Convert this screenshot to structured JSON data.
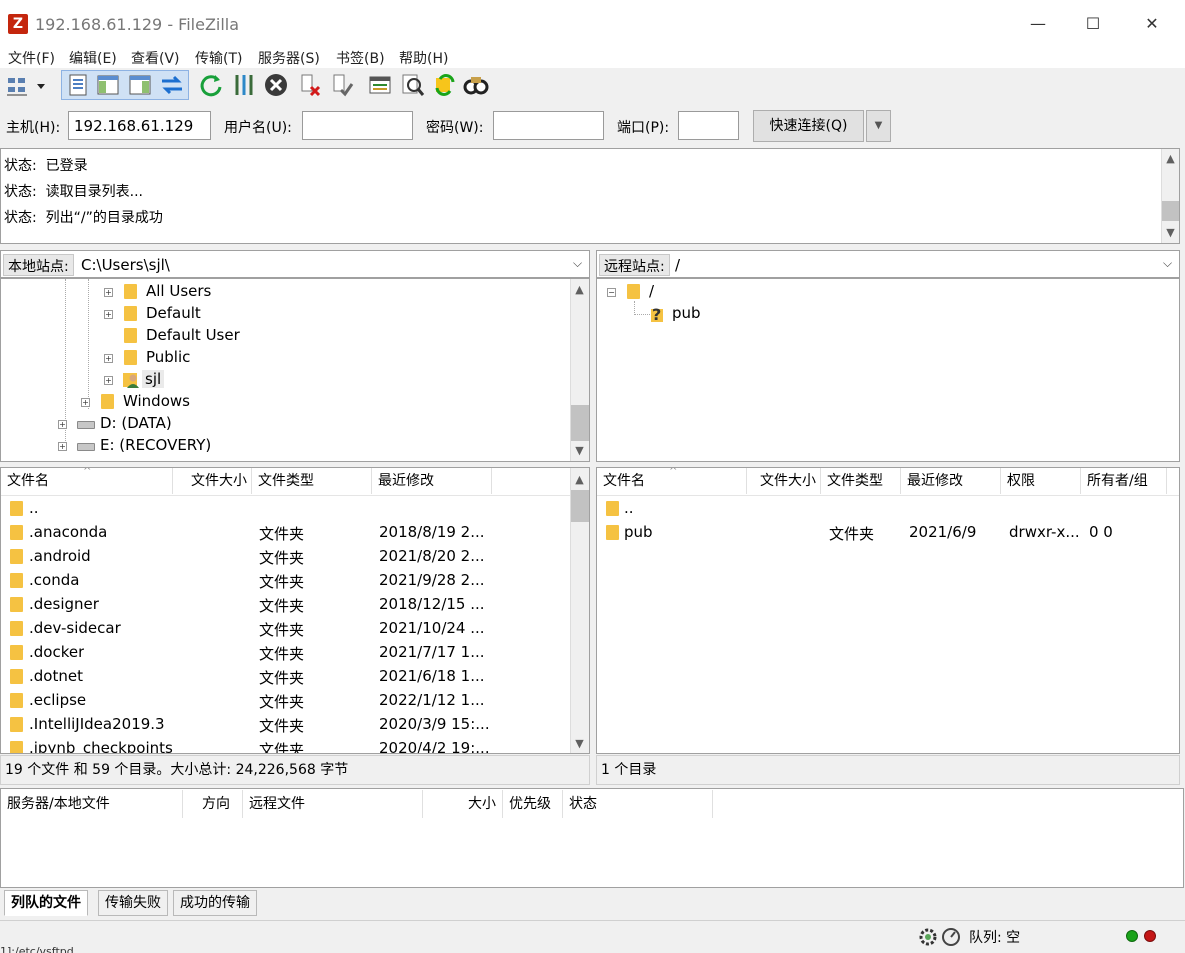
{
  "window": {
    "title": "192.168.61.129 - FileZilla",
    "app_icon_glyph": "Z",
    "minimize_glyph": "—",
    "maximize_glyph": "☐",
    "close_glyph": "✕"
  },
  "menu": [
    "文件(F)",
    "编辑(E)",
    "查看(V)",
    "传输(T)",
    "服务器(S)",
    "书签(B)",
    "帮助(H)"
  ],
  "toolbar": {
    "icons": [
      "site-manager-icon",
      "dropdown-icon",
      "toggle-log-icon",
      "toggle-local-tree-icon",
      "toggle-remote-tree-icon",
      "toggle-queue-icon",
      "refresh-icon",
      "process-queue-icon",
      "cancel-icon",
      "disconnect-icon",
      "reconnect-icon",
      "filter-icon",
      "compare-icon",
      "sync-browse-icon",
      "search-icon"
    ]
  },
  "quickconnect": {
    "host_label": "主机(H):",
    "host_value": "192.168.61.129",
    "user_label": "用户名(U):",
    "user_value": "",
    "pass_label": "密码(W):",
    "pass_value": "",
    "port_label": "端口(P):",
    "port_value": "",
    "button_label": "快速连接(Q)",
    "dropdown_glyph": "▼"
  },
  "log": [
    {
      "label": "状态:",
      "text": "已登录"
    },
    {
      "label": "状态:",
      "text": "读取目录列表..."
    },
    {
      "label": "状态:",
      "text": "列出“/”的目录成功"
    }
  ],
  "local": {
    "site_label": "本地站点:",
    "path": "C:\\Users\\sjl\\",
    "tree": [
      {
        "name": "All Users",
        "kind": "folder",
        "expander": "+"
      },
      {
        "name": "Default",
        "kind": "folder",
        "expander": "+"
      },
      {
        "name": "Default User",
        "kind": "folder",
        "expander": ""
      },
      {
        "name": "Public",
        "kind": "folder",
        "expander": "+"
      },
      {
        "name": "sjl",
        "kind": "user",
        "expander": "+"
      },
      {
        "name": "Windows",
        "kind": "folder",
        "expander": "+"
      },
      {
        "name": "D: (DATA)",
        "kind": "drive",
        "expander": "+"
      },
      {
        "name": "E: (RECOVERY)",
        "kind": "drive",
        "expander": "+"
      }
    ],
    "columns": [
      "文件名",
      "文件大小",
      "文件类型",
      "最近修改"
    ],
    "files": [
      {
        "name": "..",
        "size": "",
        "type": "",
        "modified": ""
      },
      {
        "name": ".anaconda",
        "size": "",
        "type": "文件夹",
        "modified": "2018/8/19 2..."
      },
      {
        "name": ".android",
        "size": "",
        "type": "文件夹",
        "modified": "2021/8/20 2..."
      },
      {
        "name": ".conda",
        "size": "",
        "type": "文件夹",
        "modified": "2021/9/28 2..."
      },
      {
        "name": ".designer",
        "size": "",
        "type": "文件夹",
        "modified": "2018/12/15 ..."
      },
      {
        "name": ".dev-sidecar",
        "size": "",
        "type": "文件夹",
        "modified": "2021/10/24 ..."
      },
      {
        "name": ".docker",
        "size": "",
        "type": "文件夹",
        "modified": "2021/7/17 1..."
      },
      {
        "name": ".dotnet",
        "size": "",
        "type": "文件夹",
        "modified": "2021/6/18 1..."
      },
      {
        "name": ".eclipse",
        "size": "",
        "type": "文件夹",
        "modified": "2022/1/12 1..."
      },
      {
        "name": ".IntelliJIdea2019.3",
        "size": "",
        "type": "文件夹",
        "modified": "2020/3/9 15:..."
      },
      {
        "name": ".ipynb_checkpoints",
        "size": "",
        "type": "文件夹",
        "modified": "2020/4/2 19:..."
      }
    ],
    "status": "19 个文件 和 59 个目录。大小总计: 24,226,568 字节"
  },
  "remote": {
    "site_label": "远程站点:",
    "path": "/",
    "tree": [
      {
        "name": "/",
        "kind": "folder",
        "expander": "−"
      },
      {
        "name": "pub",
        "kind": "unknown",
        "expander": ""
      }
    ],
    "columns": [
      "文件名",
      "文件大小",
      "文件类型",
      "最近修改",
      "权限",
      "所有者/组"
    ],
    "files": [
      {
        "name": "..",
        "size": "",
        "type": "",
        "modified": "",
        "perms": "",
        "owner": ""
      },
      {
        "name": "pub",
        "size": "",
        "type": "文件夹",
        "modified": "2021/6/9",
        "perms": "drwxr-x...",
        "owner": "0 0"
      }
    ],
    "status": "1 个目录"
  },
  "queue": {
    "columns": [
      "服务器/本地文件",
      "方向",
      "远程文件",
      "大小",
      "优先级",
      "状态"
    ],
    "tabs": [
      "列队的文件",
      "传输失败",
      "成功的传输"
    ],
    "active_tab": 0
  },
  "bottom": {
    "queue_label": "队列: 空",
    "overlap_text": "1]:/etc/vsftpd"
  },
  "colors": {
    "accent": "#c4260d",
    "folder": "#f5c242",
    "led_green": "#1aa31a",
    "led_red": "#c41616"
  }
}
